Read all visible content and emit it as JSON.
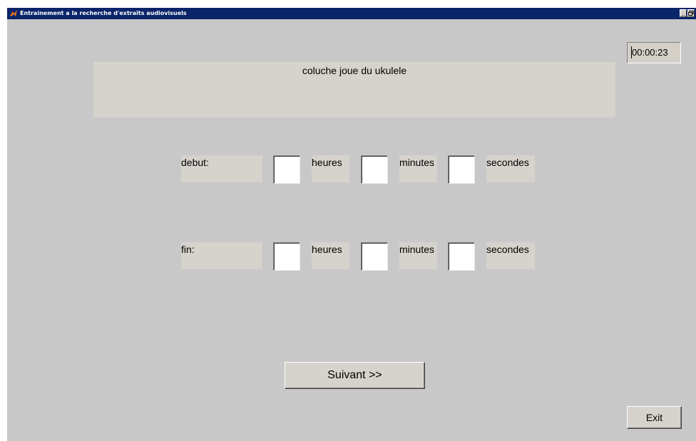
{
  "window": {
    "title": "Entrainement a la recherche d'extraits audiovisuels",
    "controls": [
      "_",
      "\u0000"
    ]
  },
  "timer": "00:00:23",
  "question": "coluche joue du ukulele",
  "rows": {
    "debut": {
      "label": "debut:",
      "hours_label": "heures",
      "minutes_label": "minutes",
      "seconds_label": "secondes",
      "hours_value": "",
      "minutes_value": "",
      "seconds_value": ""
    },
    "fin": {
      "label": "fin:",
      "hours_label": "heures",
      "minutes_label": "minutes",
      "seconds_label": "secondes",
      "hours_value": "",
      "minutes_value": "",
      "seconds_value": ""
    }
  },
  "buttons": {
    "next_label": "Suivant >>",
    "exit_label": "Exit"
  },
  "colors": {
    "titlebar": "#0a246a",
    "background": "#c8c8c8",
    "panel": "#d6d2cc"
  },
  "icons": [
    "matlab-icon",
    "minimize-icon",
    "maximize-icon"
  ]
}
